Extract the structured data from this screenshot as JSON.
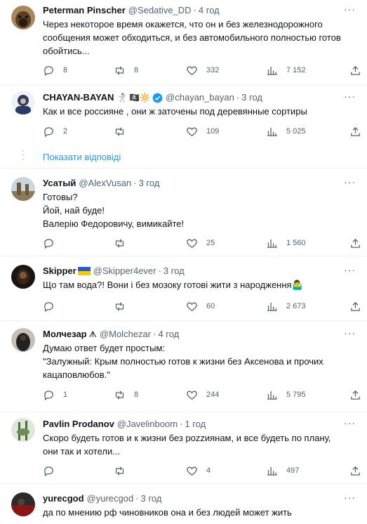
{
  "tweets": [
    {
      "name": "Peterman Pinscher",
      "handle": "@Sedative_DD",
      "time": "4 год",
      "lines": [
        "Через некоторое время окажется, что он и без железнодорожного",
        "сообщения может обходиться, и без автомобильного полностью готов",
        "обойтись..."
      ],
      "replies": "8",
      "retweets": "8",
      "likes": "332",
      "views": "7 152"
    },
    {
      "name": "CHAYAN-BAYAN",
      "name_emojis": "🤺 🏴‍☠️🔆",
      "handle": "@chayan_bayan",
      "time": "3 год",
      "lines": [
        "Как и все россияне , они ж заточены под деревянные сортиры"
      ],
      "replies": "2",
      "retweets": "",
      "likes": "109",
      "views": "5 025"
    },
    {
      "name": "Усатый",
      "handle": "@AlexVusan",
      "time": "3 год",
      "lines": [
        "Готовы?",
        "Йой, най буде!",
        "Валерію Федоровичу, вимикайте!"
      ],
      "replies": "",
      "retweets": "",
      "likes": "25",
      "views": "1 560"
    },
    {
      "name": "Skipper",
      "handle": "@Skipper4ever",
      "time": "3 год",
      "lines": [
        "Що там вода?! Вони і без мозоку готові жити з народження🤷‍♂️"
      ],
      "replies": "",
      "retweets": "",
      "likes": "60",
      "views": "2 673"
    },
    {
      "name": "Молчезар",
      "name_emojis": "ᗑ",
      "handle": "@Molchezar",
      "time": "4 год",
      "lines": [
        "Думаю ответ будет простым:",
        "\"Залужный: Крым полностью готов к жизни без Аксенова и прочих",
        "кацаповлюбов.\""
      ],
      "replies": "1",
      "retweets": "8",
      "likes": "244",
      "views": "5 795"
    },
    {
      "name": "Pavlin Prodanov",
      "handle": "@Javelinboom",
      "time": "1 год",
      "lines": [
        "Скоро будеть готов и к жизни без pozzиянам, и все будеть по плану,",
        "они так и хотели..."
      ],
      "replies": "",
      "retweets": "",
      "likes": "4",
      "views": "497"
    },
    {
      "name": "yurecgod",
      "handle": "@yurecgod",
      "time": "3 год",
      "lines": [
        "да по мнению рф чиновников она и без людей может жить"
      ],
      "replies": "",
      "retweets": "",
      "likes": "",
      "views": ""
    }
  ],
  "show_replies_label": "Показати відповіді",
  "more_label": "···",
  "colors": {
    "accent": "#1d9bf0",
    "secondary_text": "#536471",
    "divider": "#eff3f4",
    "verified": "#1d9bf0"
  }
}
